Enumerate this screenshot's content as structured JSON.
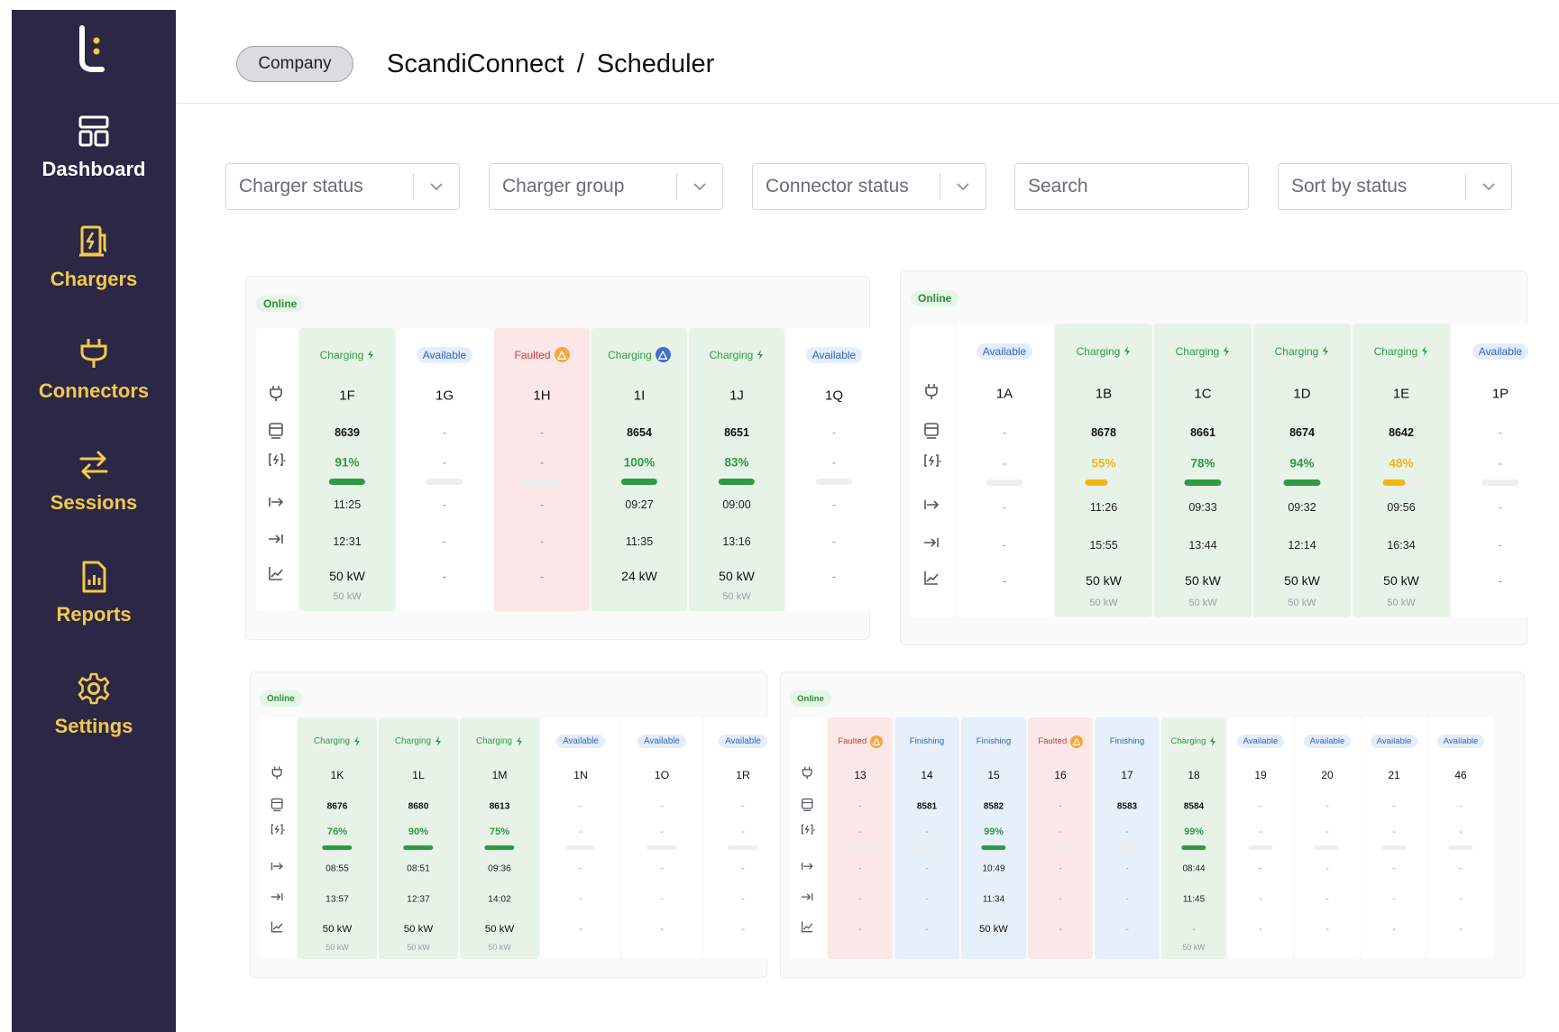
{
  "sidebar": {
    "logo_icon": "brand-logo-icon",
    "items": [
      {
        "label": "Dashboard",
        "icon": "dashboard-icon"
      },
      {
        "label": "Chargers",
        "icon": "charger-icon"
      },
      {
        "label": "Connectors",
        "icon": "plug-icon"
      },
      {
        "label": "Sessions",
        "icon": "transfer-arrows-icon"
      },
      {
        "label": "Reports",
        "icon": "report-icon"
      },
      {
        "label": "Settings",
        "icon": "gear-icon"
      }
    ]
  },
  "header": {
    "company_label": "Company",
    "breadcrumb": [
      "ScandiConnect",
      "Scheduler"
    ],
    "separator": "/"
  },
  "filters": {
    "charger_status": "Charger status",
    "charger_group": "Charger group",
    "connector_status": "Connector status",
    "search_placeholder": "Search",
    "sort": "Sort by status"
  },
  "colors": {
    "sidebar_bg": "#2c2745",
    "nav_accent": "#f2c94c",
    "charging_green": "#2e9b45",
    "low_charge_yellow": "#f2b714",
    "fault_red": "#d23b3b",
    "available_blue": "#2f66c2"
  },
  "row_icons": [
    "plug-icon",
    "battery-icon",
    "charge-level-icon",
    "start-time-icon",
    "end-time-icon",
    "power-chart-icon"
  ],
  "chargers": [
    {
      "status": "Online",
      "connectors": [
        {
          "status": "Charging",
          "name": "1F",
          "kwh": "8639",
          "pct": "91%",
          "level": 91,
          "start": "11:25",
          "end": "12:31",
          "power": "50 kW",
          "max": "50 kW"
        },
        {
          "status": "Available",
          "name": "1G",
          "kwh": "-",
          "pct": "-",
          "level": 0,
          "start": "-",
          "end": "-",
          "power": "-",
          "max": ""
        },
        {
          "status": "Faulted",
          "name": "1H",
          "kwh": "-",
          "pct": "-",
          "level": 0,
          "start": "-",
          "end": "-",
          "power": "-",
          "max": ""
        },
        {
          "status": "Charging",
          "name": "1I",
          "kwh": "8654",
          "pct": "100%",
          "level": 100,
          "start": "09:27",
          "end": "11:35",
          "power": "24 kW",
          "max": "",
          "alert": "blue"
        },
        {
          "status": "Charging",
          "name": "1J",
          "kwh": "8651",
          "pct": "83%",
          "level": 83,
          "start": "09:00",
          "end": "13:16",
          "power": "50 kW",
          "max": "50 kW"
        },
        {
          "status": "Available",
          "name": "1Q",
          "kwh": "-",
          "pct": "-",
          "level": 0,
          "start": "-",
          "end": "-",
          "power": "-",
          "max": ""
        }
      ]
    },
    {
      "status": "Online",
      "connectors": [
        {
          "status": "Available",
          "name": "1A",
          "kwh": "-",
          "pct": "-",
          "level": 0,
          "start": "-",
          "end": "-",
          "power": "-",
          "max": ""
        },
        {
          "status": "Charging",
          "name": "1B",
          "kwh": "8678",
          "pct": "55%",
          "level": 55,
          "start": "11:26",
          "end": "15:55",
          "power": "50 kW",
          "max": "50 kW"
        },
        {
          "status": "Charging",
          "name": "1C",
          "kwh": "8661",
          "pct": "78%",
          "level": 78,
          "start": "09:33",
          "end": "13:44",
          "power": "50 kW",
          "max": "50 kW"
        },
        {
          "status": "Charging",
          "name": "1D",
          "kwh": "8674",
          "pct": "94%",
          "level": 94,
          "start": "09:32",
          "end": "12:14",
          "power": "50 kW",
          "max": "50 kW"
        },
        {
          "status": "Charging",
          "name": "1E",
          "kwh": "8642",
          "pct": "48%",
          "level": 48,
          "start": "09:56",
          "end": "16:34",
          "power": "50 kW",
          "max": "50 kW"
        },
        {
          "status": "Available",
          "name": "1P",
          "kwh": "-",
          "pct": "-",
          "level": 0,
          "start": "-",
          "end": "-",
          "power": "-",
          "max": ""
        }
      ]
    },
    {
      "status": "Online",
      "connectors": [
        {
          "status": "Charging",
          "name": "1K",
          "kwh": "8676",
          "pct": "76%",
          "level": 76,
          "start": "08:55",
          "end": "13:57",
          "power": "50 kW",
          "max": "50 kW"
        },
        {
          "status": "Charging",
          "name": "1L",
          "kwh": "8680",
          "pct": "90%",
          "level": 90,
          "start": "08:51",
          "end": "12:37",
          "power": "50 kW",
          "max": "50 kW"
        },
        {
          "status": "Charging",
          "name": "1M",
          "kwh": "8613",
          "pct": "75%",
          "level": 75,
          "start": "09:36",
          "end": "14:02",
          "power": "50 kW",
          "max": "50 kW"
        },
        {
          "status": "Available",
          "name": "1N",
          "kwh": "-",
          "pct": "-",
          "level": 0,
          "start": "-",
          "end": "-",
          "power": "-",
          "max": ""
        },
        {
          "status": "Available",
          "name": "1O",
          "kwh": "-",
          "pct": "-",
          "level": 0,
          "start": "-",
          "end": "-",
          "power": "-",
          "max": ""
        },
        {
          "status": "Available",
          "name": "1R",
          "kwh": "-",
          "pct": "-",
          "level": 0,
          "start": "-",
          "end": "-",
          "power": "-",
          "max": ""
        }
      ]
    },
    {
      "status": "Online",
      "connectors": [
        {
          "status": "Faulted",
          "name": "13",
          "kwh": "-",
          "pct": "-",
          "level": 0,
          "start": "-",
          "end": "-",
          "power": "-",
          "max": ""
        },
        {
          "status": "Finishing",
          "name": "14",
          "kwh": "8581",
          "pct": "-",
          "level": 0,
          "start": "-",
          "end": "-",
          "power": "-",
          "max": ""
        },
        {
          "status": "Finishing",
          "name": "15",
          "kwh": "8582",
          "pct": "99%",
          "level": 99,
          "start": "10:49",
          "end": "11:34",
          "power": "50 kW",
          "max": ""
        },
        {
          "status": "Faulted",
          "name": "16",
          "kwh": "-",
          "pct": "-",
          "level": 0,
          "start": "-",
          "end": "-",
          "power": "-",
          "max": ""
        },
        {
          "status": "Finishing",
          "name": "17",
          "kwh": "8583",
          "pct": "-",
          "level": 0,
          "start": "-",
          "end": "-",
          "power": "-",
          "max": ""
        },
        {
          "status": "Charging",
          "name": "18",
          "kwh": "8584",
          "pct": "99%",
          "level": 99,
          "start": "08:44",
          "end": "11:45",
          "power": "-",
          "max": "50 kW"
        },
        {
          "status": "Available",
          "name": "19",
          "kwh": "-",
          "pct": "-",
          "level": 0,
          "start": "-",
          "end": "-",
          "power": "-",
          "max": ""
        },
        {
          "status": "Available",
          "name": "20",
          "kwh": "-",
          "pct": "-",
          "level": 0,
          "start": "-",
          "end": "-",
          "power": "-",
          "max": ""
        },
        {
          "status": "Available",
          "name": "21",
          "kwh": "-",
          "pct": "-",
          "level": 0,
          "start": "-",
          "end": "-",
          "power": "-",
          "max": ""
        },
        {
          "status": "Available",
          "name": "46",
          "kwh": "-",
          "pct": "-",
          "level": 0,
          "start": "-",
          "end": "-",
          "power": "-",
          "max": ""
        }
      ]
    }
  ]
}
